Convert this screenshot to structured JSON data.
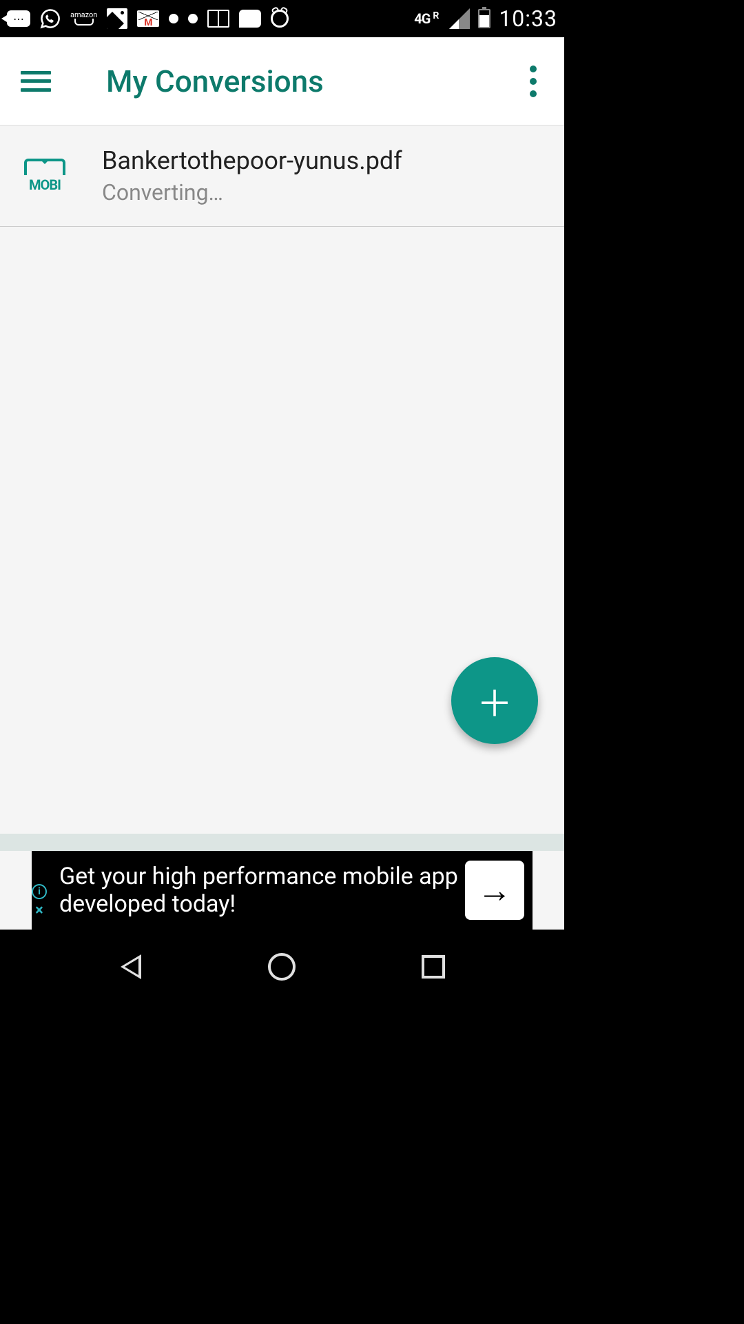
{
  "status_bar": {
    "network_type": "4G",
    "roaming": "R",
    "time": "10:33"
  },
  "app_bar": {
    "title": "My Conversions"
  },
  "list": {
    "items": [
      {
        "icon_label": "MOBI",
        "filename": "Bankertothepoor-yunus.pdf",
        "status": "Converting…"
      }
    ]
  },
  "ad": {
    "text": "Get your high performance mobile app developed today!",
    "info": "i",
    "close": "×"
  }
}
